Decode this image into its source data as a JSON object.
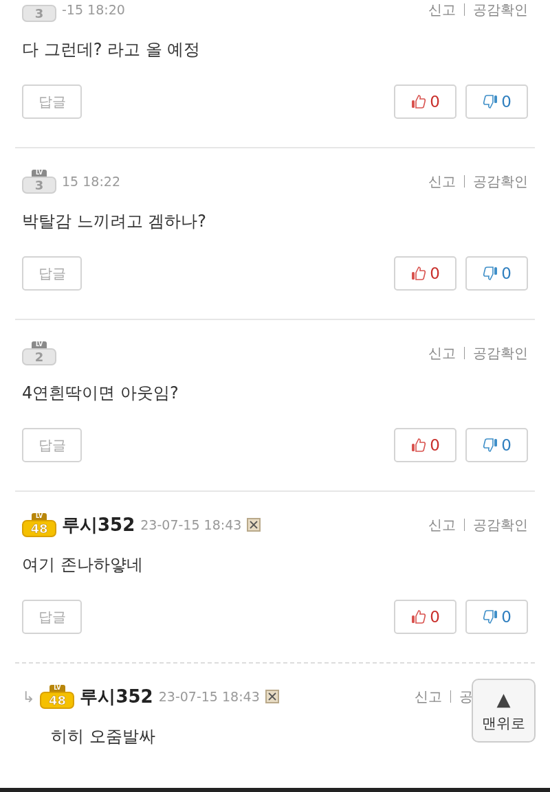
{
  "comments": [
    {
      "reply": false,
      "badge": {
        "color": "#e6e6e6",
        "level": "3"
      },
      "date": "-15 18:20",
      "report": "신고",
      "empathy": "공감확인",
      "text": "다 그런데?  라고 올 예정",
      "reply_button": "답글",
      "likes": "0",
      "dislikes": "0"
    },
    {
      "reply": false,
      "badge": {
        "color": "#e6e6e6",
        "lv": "LV",
        "level": "3"
      },
      "date": "15 18:22",
      "report": "신고",
      "empathy": "공감확인",
      "text": "박탈감 느끼려고 겜하나?",
      "reply_button": "답글",
      "likes": "0",
      "dislikes": "0"
    },
    {
      "reply": false,
      "badge": {
        "color": "#e6e6e6",
        "lv": "LV",
        "level": "2"
      },
      "report": "신고",
      "empathy": "공감확인",
      "text": "4연흰딱이면 아웃임?",
      "reply_button": "답글",
      "likes": "0",
      "dislikes": "0"
    },
    {
      "reply": false,
      "badge": {
        "color": "#f5c000",
        "lv": "LV",
        "level": "48"
      },
      "name": "루시352",
      "date": "23-07-15 18:43",
      "report": "신고",
      "empathy": "공감확인",
      "text": "여기 존나하얗네",
      "reply_button": "답글",
      "likes": "0",
      "dislikes": "0"
    },
    {
      "reply": true,
      "arrow": "↳",
      "badge": {
        "color": "#f5c000",
        "lv": "LV",
        "level": "48"
      },
      "name": "루시352",
      "date": "23-07-15 18:43",
      "report": "신고",
      "empathy": "공",
      "text": "히히 오줌발싸"
    }
  ],
  "top_button": {
    "arrow": "▲",
    "label": "맨위로"
  }
}
